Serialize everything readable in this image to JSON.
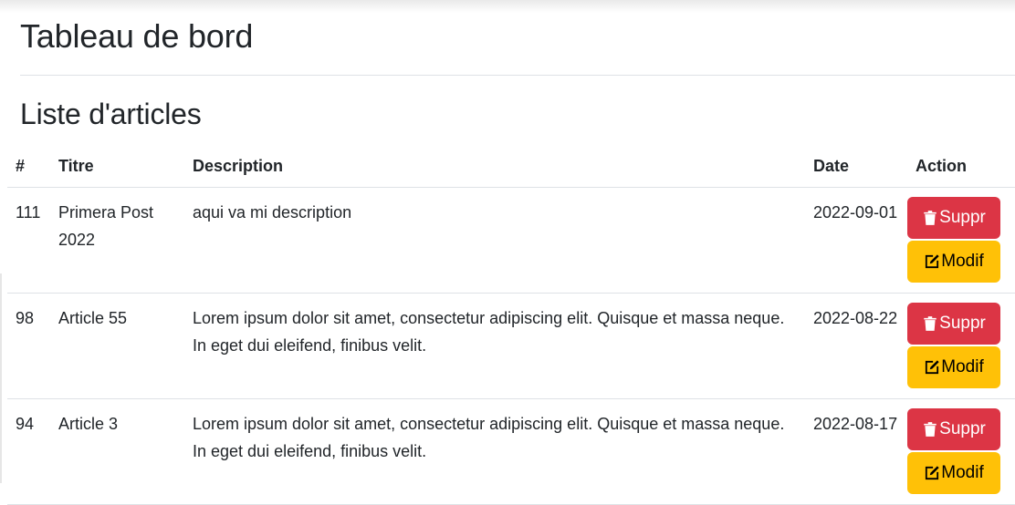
{
  "page": {
    "title": "Tableau de bord",
    "section_title": "Liste d'articles"
  },
  "table": {
    "headers": {
      "id": "#",
      "title": "Titre",
      "description": "Description",
      "date": "Date",
      "action": "Action"
    },
    "rows": [
      {
        "id": "111",
        "title": "Primera Post 2022",
        "description": "aqui va mi description",
        "date": "2022-09-01",
        "delete_label": "Suppr",
        "edit_label": "Modif"
      },
      {
        "id": "98",
        "title": "Article 55",
        "description": "Lorem ipsum dolor sit amet, consectetur adipiscing elit. Quisque et massa neque. In eget dui eleifend, finibus velit.",
        "date": "2022-08-22",
        "delete_label": "Suppr",
        "edit_label": "Modif"
      },
      {
        "id": "94",
        "title": "Article 3",
        "description": "Lorem ipsum dolor sit amet, consectetur adipiscing elit. Quisque et massa neque. In eget dui eleifend, finibus velit.",
        "date": "2022-08-17",
        "delete_label": "Suppr",
        "edit_label": "Modif"
      }
    ]
  },
  "icons": {
    "delete": "trash-icon",
    "edit": "edit-icon"
  },
  "colors": {
    "danger": "#dc3545",
    "warning": "#ffc107",
    "text": "#212529",
    "divider": "#dee2e6"
  }
}
